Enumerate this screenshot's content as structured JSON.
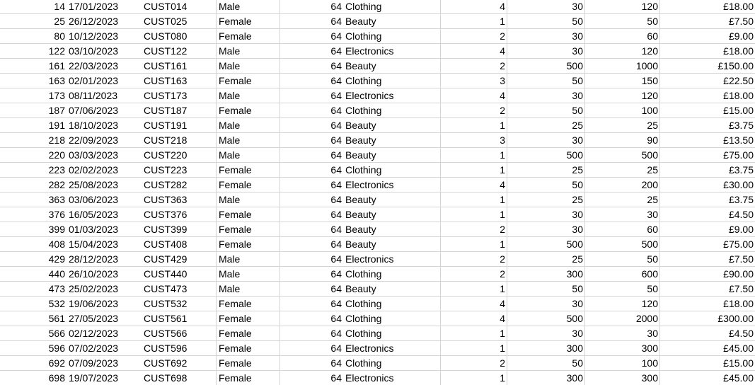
{
  "rows": [
    [
      "14",
      "17/01/2023",
      "CUST014",
      "Male",
      "64",
      "Clothing",
      "4",
      "30",
      "120",
      "£18.00"
    ],
    [
      "25",
      "26/12/2023",
      "CUST025",
      "Female",
      "64",
      "Beauty",
      "1",
      "50",
      "50",
      "£7.50"
    ],
    [
      "80",
      "10/12/2023",
      "CUST080",
      "Female",
      "64",
      "Clothing",
      "2",
      "30",
      "60",
      "£9.00"
    ],
    [
      "122",
      "03/10/2023",
      "CUST122",
      "Male",
      "64",
      "Electronics",
      "4",
      "30",
      "120",
      "£18.00"
    ],
    [
      "161",
      "22/03/2023",
      "CUST161",
      "Male",
      "64",
      "Beauty",
      "2",
      "500",
      "1000",
      "£150.00"
    ],
    [
      "163",
      "02/01/2023",
      "CUST163",
      "Female",
      "64",
      "Clothing",
      "3",
      "50",
      "150",
      "£22.50"
    ],
    [
      "173",
      "08/11/2023",
      "CUST173",
      "Male",
      "64",
      "Electronics",
      "4",
      "30",
      "120",
      "£18.00"
    ],
    [
      "187",
      "07/06/2023",
      "CUST187",
      "Female",
      "64",
      "Clothing",
      "2",
      "50",
      "100",
      "£15.00"
    ],
    [
      "191",
      "18/10/2023",
      "CUST191",
      "Male",
      "64",
      "Beauty",
      "1",
      "25",
      "25",
      "£3.75"
    ],
    [
      "218",
      "22/09/2023",
      "CUST218",
      "Male",
      "64",
      "Beauty",
      "3",
      "30",
      "90",
      "£13.50"
    ],
    [
      "220",
      "03/03/2023",
      "CUST220",
      "Male",
      "64",
      "Beauty",
      "1",
      "500",
      "500",
      "£75.00"
    ],
    [
      "223",
      "02/02/2023",
      "CUST223",
      "Female",
      "64",
      "Clothing",
      "1",
      "25",
      "25",
      "£3.75"
    ],
    [
      "282",
      "25/08/2023",
      "CUST282",
      "Female",
      "64",
      "Electronics",
      "4",
      "50",
      "200",
      "£30.00"
    ],
    [
      "363",
      "03/06/2023",
      "CUST363",
      "Male",
      "64",
      "Beauty",
      "1",
      "25",
      "25",
      "£3.75"
    ],
    [
      "376",
      "16/05/2023",
      "CUST376",
      "Female",
      "64",
      "Beauty",
      "1",
      "30",
      "30",
      "£4.50"
    ],
    [
      "399",
      "01/03/2023",
      "CUST399",
      "Female",
      "64",
      "Beauty",
      "2",
      "30",
      "60",
      "£9.00"
    ],
    [
      "408",
      "15/04/2023",
      "CUST408",
      "Female",
      "64",
      "Beauty",
      "1",
      "500",
      "500",
      "£75.00"
    ],
    [
      "429",
      "28/12/2023",
      "CUST429",
      "Male",
      "64",
      "Electronics",
      "2",
      "25",
      "50",
      "£7.50"
    ],
    [
      "440",
      "26/10/2023",
      "CUST440",
      "Male",
      "64",
      "Clothing",
      "2",
      "300",
      "600",
      "£90.00"
    ],
    [
      "473",
      "25/02/2023",
      "CUST473",
      "Male",
      "64",
      "Beauty",
      "1",
      "50",
      "50",
      "£7.50"
    ],
    [
      "532",
      "19/06/2023",
      "CUST532",
      "Female",
      "64",
      "Clothing",
      "4",
      "30",
      "120",
      "£18.00"
    ],
    [
      "561",
      "27/05/2023",
      "CUST561",
      "Female",
      "64",
      "Clothing",
      "4",
      "500",
      "2000",
      "£300.00"
    ],
    [
      "566",
      "02/12/2023",
      "CUST566",
      "Female",
      "64",
      "Clothing",
      "1",
      "30",
      "30",
      "£4.50"
    ],
    [
      "596",
      "07/02/2023",
      "CUST596",
      "Female",
      "64",
      "Electronics",
      "1",
      "300",
      "300",
      "£45.00"
    ],
    [
      "692",
      "07/09/2023",
      "CUST692",
      "Female",
      "64",
      "Clothing",
      "2",
      "50",
      "100",
      "£15.00"
    ],
    [
      "698",
      "19/07/2023",
      "CUST698",
      "Female",
      "64",
      "Electronics",
      "1",
      "300",
      "300",
      "£45.00"
    ]
  ]
}
